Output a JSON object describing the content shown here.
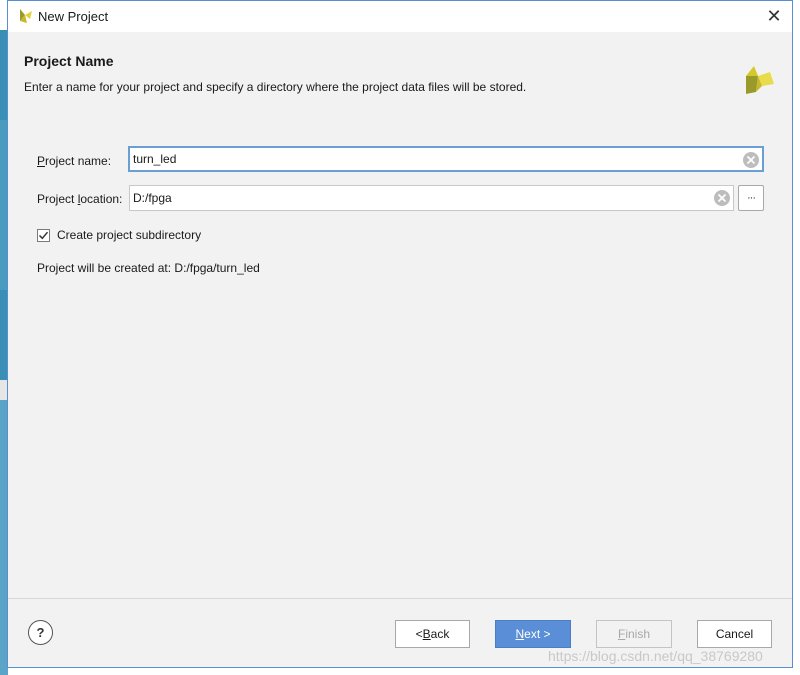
{
  "window": {
    "title": "New Project",
    "close_glyph": "✕",
    "logo_icon": "vivado-logo-icon"
  },
  "header": {
    "title": "Project Name",
    "subtitle": "Enter a name for your project and specify a directory where the project data files will be stored."
  },
  "form": {
    "name_label_mnemonic": "P",
    "name_label_rest": "roject name:",
    "name_value": "turn_led",
    "location_label_prefix": "Project ",
    "location_label_mnemonic": "l",
    "location_label_rest": "ocation:",
    "location_value": "D:/fpga",
    "browse_label": "···",
    "subdir_checked": true,
    "subdir_label": "Create project subdirectory",
    "created_at_text": "Project will be created at: D:/fpga/turn_led"
  },
  "footer": {
    "help_label": "?",
    "back_prefix": "< ",
    "back_mnemonic": "B",
    "back_rest": "ack",
    "next_mnemonic": "N",
    "next_rest": "ext >",
    "finish_mnemonic": "F",
    "finish_rest": "inish",
    "cancel_label": "Cancel"
  },
  "watermark": "https://blog.csdn.net/qq_38769280",
  "colors": {
    "accent": "#5a8ed6",
    "logo_yellow": "#e2d23a",
    "logo_olive": "#9a9a2a"
  }
}
